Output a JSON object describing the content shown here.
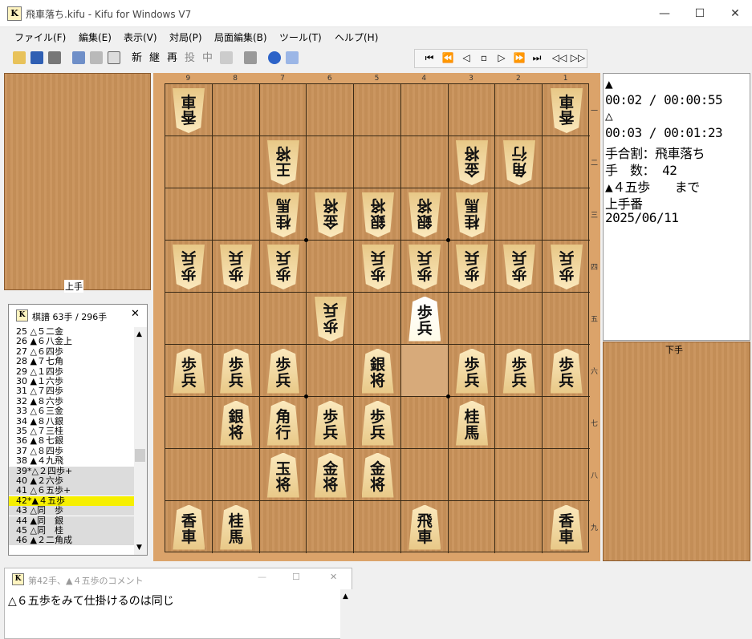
{
  "window": {
    "title": "飛車落ち.kifu - Kifu for Windows V7",
    "app_icon": "K",
    "min": "—",
    "max": "☐",
    "close": "✕"
  },
  "menu": [
    "ファイル(F)",
    "編集(E)",
    "表示(V)",
    "対局(P)",
    "局面編集(B)",
    "ツール(T)",
    "ヘルプ(H)"
  ],
  "toolbar": {
    "text_buttons": [
      "新",
      "継",
      "再",
      "投",
      "中"
    ],
    "nav_buttons": [
      "⏮",
      "⏪",
      "◁",
      "▫",
      "▷",
      "⏩",
      "⏭",
      "◁◁",
      "▷▷"
    ]
  },
  "board": {
    "columns": [
      "9",
      "8",
      "7",
      "6",
      "5",
      "4",
      "3",
      "2",
      "1"
    ],
    "rows": [
      "一",
      "二",
      "三",
      "四",
      "五",
      "六",
      "七",
      "八",
      "九"
    ],
    "highlight": {
      "col": 5,
      "row": 5
    },
    "pieces": [
      {
        "c": 0,
        "r": 0,
        "t": "香車",
        "s": "g"
      },
      {
        "c": 8,
        "r": 0,
        "t": "香車",
        "s": "g"
      },
      {
        "c": 2,
        "r": 1,
        "t": "王将",
        "s": "g"
      },
      {
        "c": 6,
        "r": 1,
        "t": "金将",
        "s": "g"
      },
      {
        "c": 7,
        "r": 1,
        "t": "角行",
        "s": "g"
      },
      {
        "c": 2,
        "r": 2,
        "t": "桂馬",
        "s": "g"
      },
      {
        "c": 3,
        "r": 2,
        "t": "金将",
        "s": "g"
      },
      {
        "c": 4,
        "r": 2,
        "t": "銀将",
        "s": "g"
      },
      {
        "c": 5,
        "r": 2,
        "t": "銀将",
        "s": "g"
      },
      {
        "c": 6,
        "r": 2,
        "t": "桂馬",
        "s": "g"
      },
      {
        "c": 0,
        "r": 3,
        "t": "歩兵",
        "s": "g"
      },
      {
        "c": 1,
        "r": 3,
        "t": "歩兵",
        "s": "g"
      },
      {
        "c": 2,
        "r": 3,
        "t": "歩兵",
        "s": "g"
      },
      {
        "c": 4,
        "r": 3,
        "t": "歩兵",
        "s": "g"
      },
      {
        "c": 5,
        "r": 3,
        "t": "歩兵",
        "s": "g"
      },
      {
        "c": 6,
        "r": 3,
        "t": "歩兵",
        "s": "g"
      },
      {
        "c": 7,
        "r": 3,
        "t": "歩兵",
        "s": "g"
      },
      {
        "c": 8,
        "r": 3,
        "t": "歩兵",
        "s": "g"
      },
      {
        "c": 3,
        "r": 4,
        "t": "歩兵",
        "s": "g"
      },
      {
        "c": 5,
        "r": 4,
        "t": "歩兵",
        "s": "s",
        "sel": true
      },
      {
        "c": 0,
        "r": 5,
        "t": "歩兵",
        "s": "s"
      },
      {
        "c": 1,
        "r": 5,
        "t": "歩兵",
        "s": "s"
      },
      {
        "c": 2,
        "r": 5,
        "t": "歩兵",
        "s": "s"
      },
      {
        "c": 4,
        "r": 5,
        "t": "銀将",
        "s": "s"
      },
      {
        "c": 6,
        "r": 5,
        "t": "歩兵",
        "s": "s"
      },
      {
        "c": 7,
        "r": 5,
        "t": "歩兵",
        "s": "s"
      },
      {
        "c": 8,
        "r": 5,
        "t": "歩兵",
        "s": "s"
      },
      {
        "c": 1,
        "r": 6,
        "t": "銀将",
        "s": "s"
      },
      {
        "c": 2,
        "r": 6,
        "t": "角行",
        "s": "s"
      },
      {
        "c": 3,
        "r": 6,
        "t": "歩兵",
        "s": "s"
      },
      {
        "c": 4,
        "r": 6,
        "t": "歩兵",
        "s": "s"
      },
      {
        "c": 6,
        "r": 6,
        "t": "桂馬",
        "s": "s"
      },
      {
        "c": 2,
        "r": 7,
        "t": "玉将",
        "s": "s"
      },
      {
        "c": 3,
        "r": 7,
        "t": "金将",
        "s": "s"
      },
      {
        "c": 4,
        "r": 7,
        "t": "金将",
        "s": "s"
      },
      {
        "c": 0,
        "r": 8,
        "t": "香車",
        "s": "s"
      },
      {
        "c": 1,
        "r": 8,
        "t": "桂馬",
        "s": "s"
      },
      {
        "c": 5,
        "r": 8,
        "t": "飛車",
        "s": "s"
      },
      {
        "c": 8,
        "r": 8,
        "t": "香車",
        "s": "s"
      }
    ]
  },
  "stands": {
    "gote_label": "上手",
    "sente_label": "下手"
  },
  "info": {
    "sente_mark": "▲",
    "sente_time": "00:02 / 00:00:55",
    "gote_mark": "△",
    "gote_time": "00:03 / 00:01:23",
    "handicap": "手合割：飛車落ち",
    "moves": "手　数： 42",
    "last_move": "▲４五歩　　まで",
    "turn": "上手番",
    "date": "2025/06/11"
  },
  "kifu": {
    "title": "棋譜 63手 / 296手",
    "moves": [
      {
        "t": "25 △５二金"
      },
      {
        "t": "26 ▲６八金上"
      },
      {
        "t": "27 △６四歩"
      },
      {
        "t": "28 ▲７七角"
      },
      {
        "t": "29 △１四歩"
      },
      {
        "t": "30 ▲１六歩"
      },
      {
        "t": "31 △７四歩"
      },
      {
        "t": "32 ▲８六歩"
      },
      {
        "t": "33 △６三金"
      },
      {
        "t": "34 ▲８八銀"
      },
      {
        "t": "35 △７三桂"
      },
      {
        "t": "36 ▲８七銀"
      },
      {
        "t": "37 △８四歩"
      },
      {
        "t": "38 ▲４九飛"
      },
      {
        "t": "39*△２四歩+",
        "v": true
      },
      {
        "t": "40 ▲２六歩",
        "v": true
      },
      {
        "t": "41 △６五歩+",
        "v": true
      },
      {
        "t": "42*▲４五歩",
        "v": true,
        "cur": true
      },
      {
        "t": "43 △同　歩",
        "v": true
      },
      {
        "t": "44 ▲同　銀",
        "v": true
      },
      {
        "t": "45 △同　桂",
        "v": true
      },
      {
        "t": "46 ▲２二角成",
        "v": true
      }
    ]
  },
  "comment": {
    "title": "第42手、▲４五歩のコメント",
    "text": "△６五歩をみて仕掛けるのは同じ"
  }
}
